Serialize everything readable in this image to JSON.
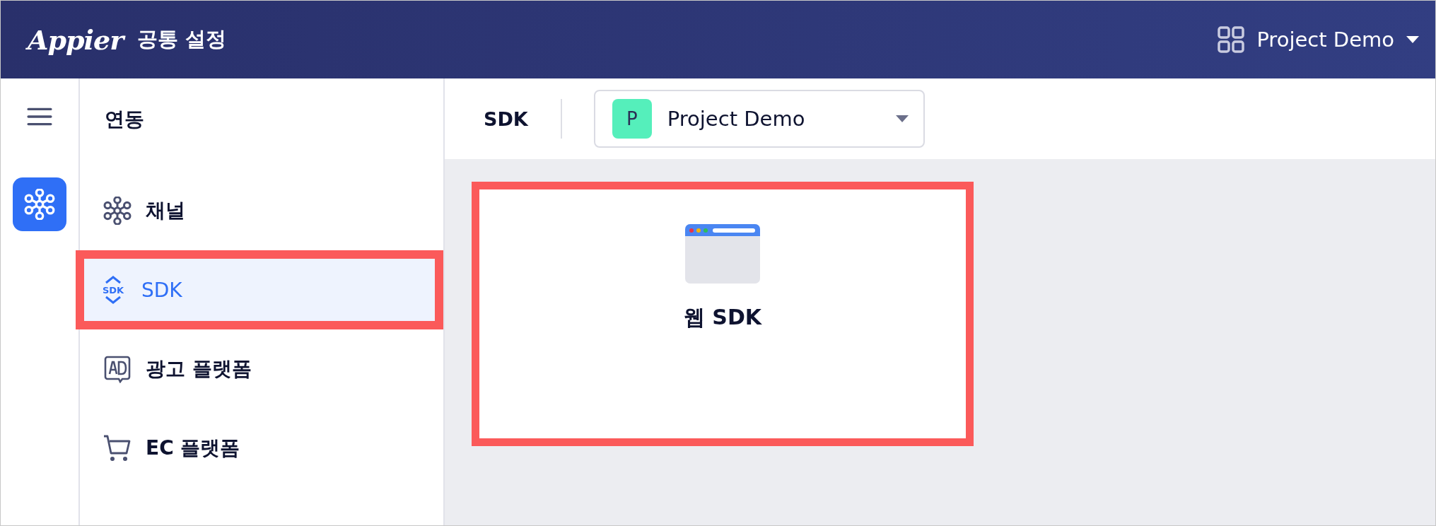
{
  "header": {
    "logo": "Appier",
    "title": "공통 설정",
    "project": "Project Demo"
  },
  "rail": {
    "items": [
      {
        "selected": true
      }
    ]
  },
  "nav": {
    "heading": "연동",
    "items": [
      {
        "label": "채널",
        "selected": false,
        "highlighted": false
      },
      {
        "label": "SDK",
        "selected": true,
        "highlighted": true,
        "icon_text": "SDK"
      },
      {
        "label": "광고 플랫폼",
        "selected": false,
        "highlighted": false
      },
      {
        "label": "EC 플랫폼",
        "selected": false,
        "highlighted": false
      }
    ]
  },
  "toolbar": {
    "title": "SDK",
    "project_select": {
      "badge": "P",
      "value": "Project Demo"
    }
  },
  "cards": [
    {
      "title": "웹 SDK",
      "highlighted": true
    }
  ]
}
